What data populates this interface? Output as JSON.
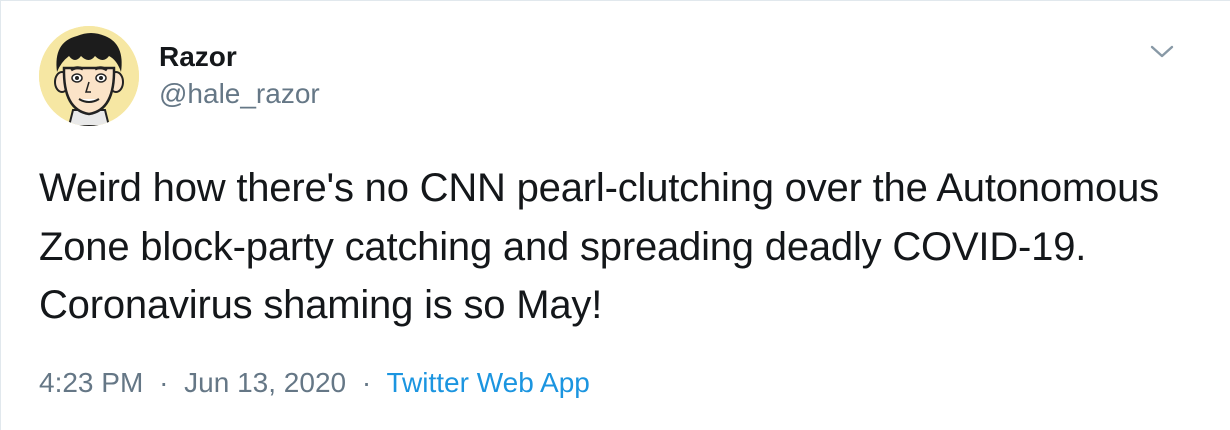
{
  "tweet": {
    "author": {
      "display_name": "Razor",
      "handle": "@hale_razor",
      "avatar_icon": "cartoon-avatar-icon"
    },
    "text": "Weird how there's no CNN pearl-clutching over the Autonomous Zone block-party catching and spreading deadly COVID-19. Coronavirus shaming is so May!",
    "time": "4:23 PM",
    "date": "Jun 13, 2020",
    "separator": "·",
    "source": "Twitter Web App",
    "menu_icon": "chevron-down-icon"
  },
  "colors": {
    "text": "#14171a",
    "secondary": "#657786",
    "link": "#1b95e0",
    "border": "#e1e8ed",
    "avatar_bg": "#f6e7a3"
  }
}
